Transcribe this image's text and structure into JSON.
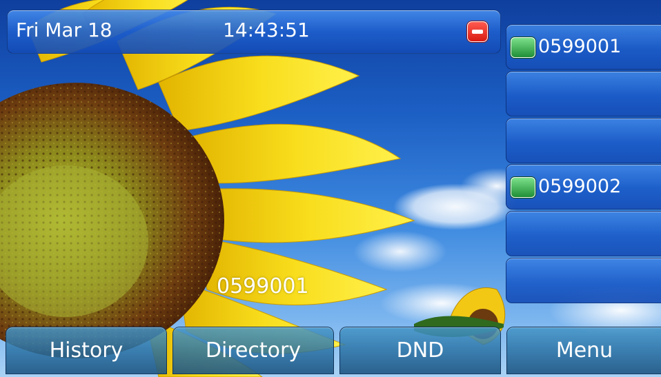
{
  "status_bar": {
    "date": "Fri Mar 18",
    "time": "14:43:51",
    "dnd_icon": "dnd-minus-icon",
    "dnd_color": "#e02a1f"
  },
  "line_keys": [
    {
      "label": "0599001",
      "icon": "phone-icon"
    },
    {
      "label": ""
    },
    {
      "label": ""
    },
    {
      "label": "0599002",
      "icon": "phone-icon"
    },
    {
      "label": ""
    },
    {
      "label": ""
    }
  ],
  "center_number": "0599001",
  "softkeys": {
    "history": "History",
    "directory": "Directory",
    "dnd": "DND",
    "menu": "Menu"
  },
  "colors": {
    "key_blue": "#1c5cc8",
    "phone_icon_green": "#2aa044",
    "sunflower_yellow": "#f5d312"
  }
}
